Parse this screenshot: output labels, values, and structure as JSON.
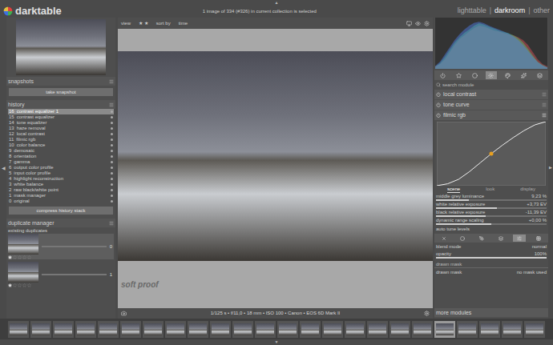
{
  "app": {
    "logo": "darktable",
    "status": "1 image of 334 (#326) in current collection is selected",
    "separator": "|",
    "views": [
      {
        "label": "lighttable",
        "selected": false
      },
      {
        "label": "darkroom",
        "selected": true
      },
      {
        "label": "other",
        "selected": false
      }
    ]
  },
  "edge_arrows": {
    "left": "◀",
    "right": "▶",
    "top": "▲",
    "bottom": "▼"
  },
  "left_panel": {
    "snapshots": {
      "title": "snapshots",
      "button": "take snapshot"
    },
    "history": {
      "title": "history",
      "button": "compress history stack",
      "items": [
        {
          "number": "16",
          "label": "contrast equalizer 1",
          "selected": true
        },
        {
          "number": "15",
          "label": "contrast equalizer",
          "selected": false
        },
        {
          "number": "14",
          "label": "tone equalizer",
          "selected": false
        },
        {
          "number": "13",
          "label": "haze removal",
          "selected": false
        },
        {
          "number": "12",
          "label": "local contrast",
          "selected": false
        },
        {
          "number": "11",
          "label": "filmic rgb",
          "selected": false
        },
        {
          "number": "10",
          "label": "color balance",
          "selected": false
        },
        {
          "number": "9",
          "label": "demosaic",
          "selected": false
        },
        {
          "number": "8",
          "label": "orientation",
          "selected": false
        },
        {
          "number": "7",
          "label": "gamma",
          "selected": false
        },
        {
          "number": "6",
          "label": "output color profile",
          "selected": false
        },
        {
          "number": "5",
          "label": "input color profile",
          "selected": false
        },
        {
          "number": "4",
          "label": "highlight reconstruction",
          "selected": false
        },
        {
          "number": "3",
          "label": "white balance",
          "selected": false
        },
        {
          "number": "2",
          "label": "raw black/white point",
          "selected": false
        },
        {
          "number": "1",
          "label": "mask manager",
          "selected": false
        },
        {
          "number": "0",
          "label": "original",
          "selected": false
        }
      ]
    },
    "duplicate_manager": {
      "title": "duplicate manager",
      "label": "existing duplicates",
      "duplicates": [
        {
          "number": "0",
          "stars": 1,
          "selected": true
        },
        {
          "number": "1",
          "stars": 1,
          "selected": false
        }
      ]
    }
  },
  "center": {
    "toolbar": {
      "view_label": "view",
      "stars": "★ ★",
      "sort_label": "sort by",
      "sort_value": "time"
    },
    "overlay": "soft proof",
    "info": "1/125 s • f/11,0 • 18 mm • ISO 100 • Canon • EOS 6D Mark II"
  },
  "right_panel": {
    "histogram": {
      "series": [
        {
          "color": "#e0505a",
          "values": [
            0.05,
            0.1,
            0.2,
            0.35,
            0.5,
            0.62,
            0.7,
            0.78,
            0.85,
            0.9,
            0.88,
            0.84,
            0.8,
            0.78,
            0.75,
            0.72,
            0.7,
            0.66,
            0.6,
            0.5,
            0.35,
            0.2,
            0.1,
            0.05
          ]
        },
        {
          "color": "#50d070",
          "values": [
            0.04,
            0.12,
            0.25,
            0.4,
            0.55,
            0.66,
            0.75,
            0.82,
            0.9,
            0.95,
            0.92,
            0.88,
            0.84,
            0.8,
            0.77,
            0.74,
            0.7,
            0.64,
            0.55,
            0.42,
            0.28,
            0.15,
            0.08,
            0.03
          ]
        },
        {
          "color": "#5080f0",
          "values": [
            0.06,
            0.15,
            0.3,
            0.45,
            0.6,
            0.72,
            0.82,
            0.9,
            0.96,
            0.98,
            0.95,
            0.9,
            0.86,
            0.82,
            0.78,
            0.74,
            0.68,
            0.6,
            0.5,
            0.38,
            0.25,
            0.14,
            0.07,
            0.03
          ]
        }
      ]
    },
    "module_groups": [
      {
        "selected": false
      },
      {
        "selected": false
      },
      {
        "selected": false
      },
      {
        "selected": true
      },
      {
        "selected": false
      },
      {
        "selected": false
      },
      {
        "selected": false
      }
    ],
    "search": {
      "placeholder": "search module"
    },
    "modules": [
      {
        "name": "local contrast",
        "enabled": true,
        "expanded": false
      },
      {
        "name": "tone curve",
        "enabled": true,
        "expanded": false
      },
      {
        "name": "filmic rgb",
        "enabled": true,
        "expanded": true
      }
    ],
    "filmic": {
      "curve": [
        0.0,
        0.03,
        0.1,
        0.22,
        0.36,
        0.5,
        0.63,
        0.75,
        0.86,
        0.95,
        1.0
      ],
      "tabs": [
        {
          "label": "scene",
          "selected": true
        },
        {
          "label": "look",
          "selected": false
        },
        {
          "label": "display",
          "selected": false
        }
      ],
      "sliders": [
        {
          "label": "middle grey luminance",
          "reading": "9,23 %",
          "level": 0.3
        },
        {
          "label": "white relative exposure",
          "reading": "+3,73 EV",
          "level": 0.55
        },
        {
          "label": "black relative exposure",
          "reading": "-11,39 EV",
          "level": 0.45
        },
        {
          "label": "dynamic range scaling",
          "reading": "+0,00 %",
          "level": 0.5
        }
      ],
      "auto_tune": "auto tune levels"
    },
    "blending": {
      "modes": [
        {
          "selected": false
        },
        {
          "selected": false
        },
        {
          "selected": false
        },
        {
          "selected": false
        },
        {
          "selected": true
        },
        {
          "selected": false
        }
      ],
      "rows": [
        {
          "kind": "select",
          "label": "blend mode",
          "value": "normal"
        },
        {
          "kind": "slider",
          "label": "opacity",
          "value": "100%",
          "level": 1
        }
      ],
      "drawn_mask_header": "drawn mask",
      "drawn_mask": {
        "label": "drawn mask",
        "value": "no mask used"
      }
    },
    "more_modules": "more modules"
  },
  "filmstrip": [
    {
      "selected": false
    },
    {
      "selected": false
    },
    {
      "selected": false
    },
    {
      "selected": false
    },
    {
      "selected": false
    },
    {
      "selected": false
    },
    {
      "selected": false
    },
    {
      "selected": false
    },
    {
      "selected": false
    },
    {
      "selected": false
    },
    {
      "selected": false
    },
    {
      "selected": false
    },
    {
      "selected": false
    },
    {
      "selected": false
    },
    {
      "selected": false
    },
    {
      "selected": false
    },
    {
      "selected": false
    },
    {
      "selected": false
    },
    {
      "selected": false
    },
    {
      "selected": true
    },
    {
      "selected": false
    },
    {
      "selected": false
    },
    {
      "selected": false
    },
    {
      "selected": false
    }
  ]
}
